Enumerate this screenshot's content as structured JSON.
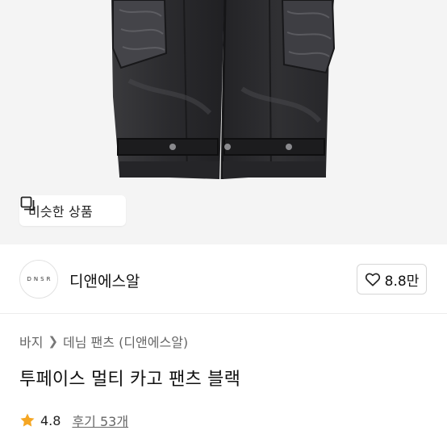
{
  "product": {
    "image_alt": "product-image",
    "similar_button_label": "비슷한 상품",
    "title": "투페이스 멀티 카고 팬츠 블랙"
  },
  "brand": {
    "logo_text": "DNSR",
    "name": "디앤에스알",
    "like_count": "8.8만"
  },
  "breadcrumb": {
    "items": [
      "바지",
      "데님 팬츠 (디앤에스알)"
    ]
  },
  "rating": {
    "score": "4.8",
    "reviews_label": "후기 53개"
  },
  "colors": {
    "star": "#f5a623",
    "denim": "#2a2a2c"
  }
}
